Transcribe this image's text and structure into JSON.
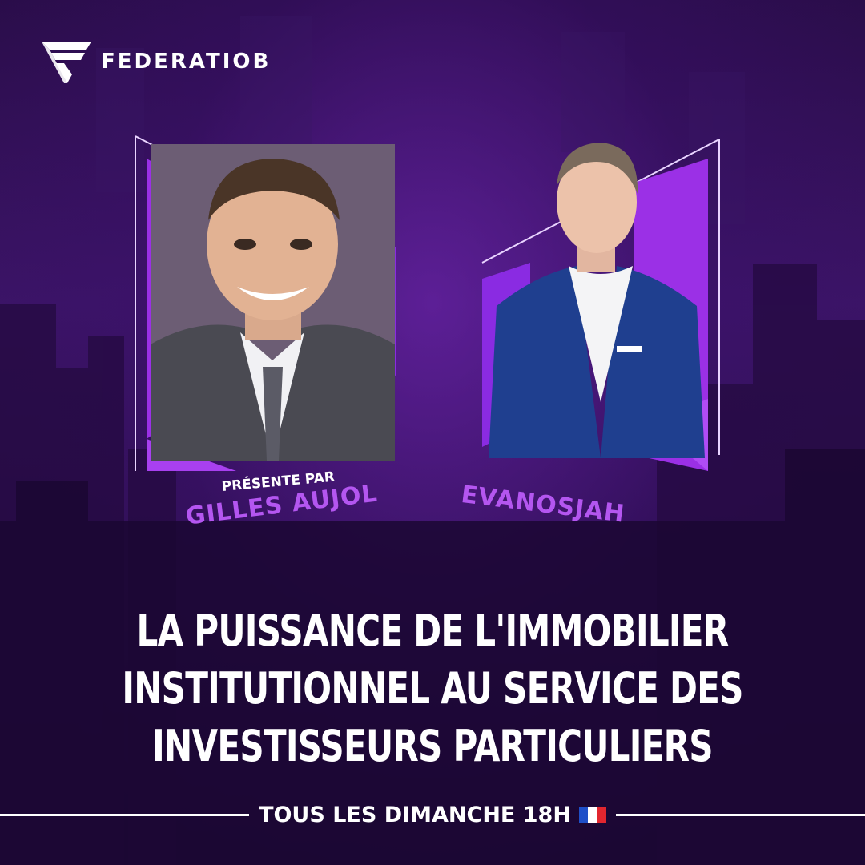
{
  "brand": {
    "name": "FEDERATIOB"
  },
  "host": {
    "prefix": "PRÉSENTE PAR",
    "name": "GILLES AUJOL"
  },
  "guest": {
    "name": "EVANOSJAH"
  },
  "headline": {
    "lines": [
      "LA PUISSANCE DE L'IMMOBILIER",
      "INSTITUTIONNEL AU SERVICE DES",
      "INVESTISSEURS PARTICULIERS"
    ]
  },
  "footer": {
    "schedule": "TOUS LES DIMANCHE 18H",
    "flag": "france-flag-icon"
  },
  "colors": {
    "accent": "#b456f0",
    "frame": "#8a2be2",
    "background": "#2a0d4a",
    "text": "#ffffff"
  }
}
